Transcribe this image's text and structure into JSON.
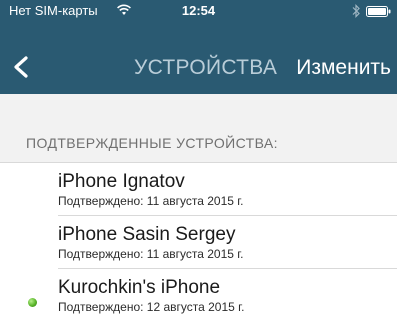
{
  "status_bar": {
    "carrier": "Нет SIM-карты",
    "time": "12:54",
    "icons": [
      "wifi-icon",
      "bluetooth-icon",
      "battery-icon"
    ]
  },
  "nav": {
    "back_icon": "chevron-left-icon",
    "title": "УСТРОЙСТВА",
    "edit_label": "Изменить"
  },
  "section": {
    "header": "ПОДТВЕРЖДЕННЫЕ УСТРОЙСТВА:"
  },
  "devices": [
    {
      "name": "iPhone Ignatov",
      "confirmed": "Подтверждено: 11 августа 2015 г.",
      "online": false
    },
    {
      "name": "iPhone Sasin Sergey",
      "confirmed": "Подтверждено: 11 августа 2015 г.",
      "online": false
    },
    {
      "name": "Kurochkin's iPhone",
      "confirmed": "Подтверждено: 12 августа 2015 г.",
      "online": true
    }
  ],
  "colors": {
    "nav_background": "#2a5a72",
    "title_color": "#b9cdd8",
    "content_background": "#f2f2f2",
    "online_indicator": "#5ab52a"
  }
}
